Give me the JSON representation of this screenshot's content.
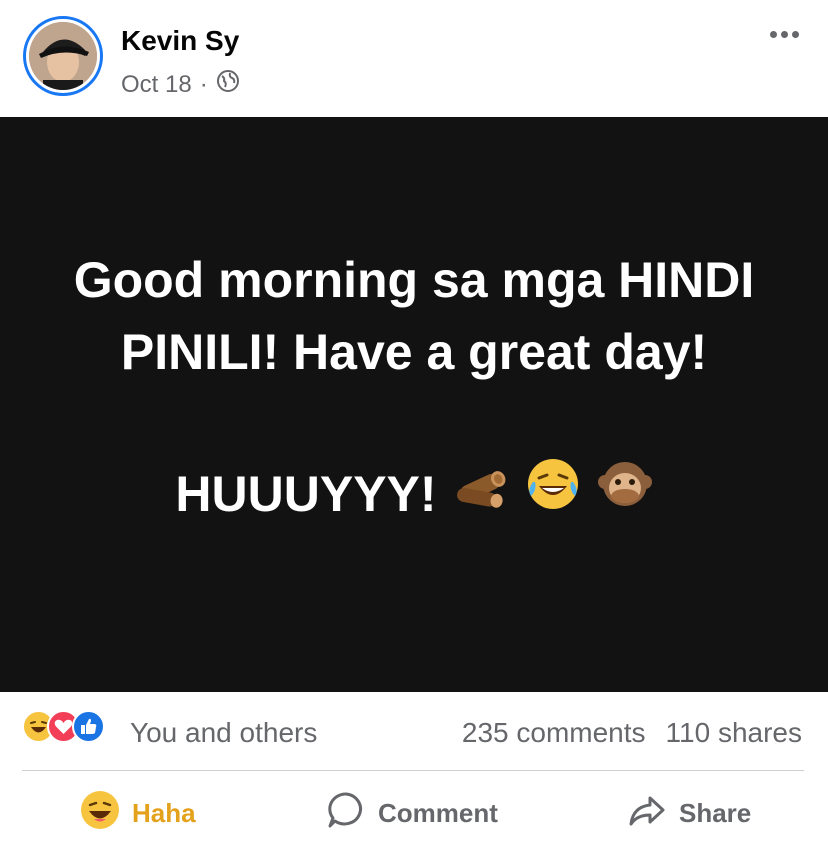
{
  "post": {
    "author_name": "Kevin Sy",
    "date": "Oct 18",
    "separator": "·",
    "audience_icon": "globe-icon",
    "more_icon": "ellipsis-icon",
    "body_line1": "Good morning sa mga HINDI PINILI! Have a great day!",
    "body_line2": "HUUUYYY!",
    "body_emojis": [
      "🪵",
      "😂",
      "🙊"
    ],
    "background_color": "#121212"
  },
  "reactions": {
    "icons": [
      "haha-reaction-icon",
      "love-reaction-icon",
      "like-reaction-icon"
    ],
    "summary": "You and others",
    "comments": "235 comments",
    "shares": "110 shares"
  },
  "actions": {
    "haha_label": "Haha",
    "comment_label": "Comment",
    "share_label": "Share"
  },
  "colors": {
    "accent": "#1877f2",
    "haha": "#e4a11b",
    "secondary_text": "#65676b"
  }
}
